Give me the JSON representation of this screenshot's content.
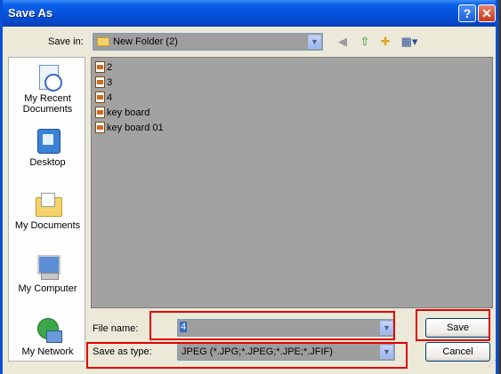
{
  "window": {
    "title": "Save As",
    "help_glyph": "?",
    "close_glyph": "✕"
  },
  "toolbar": {
    "save_in_label": "Save in:",
    "save_in_value": "New Folder (2)",
    "icons": [
      "back-icon",
      "up-folder-icon",
      "new-folder-icon",
      "views-menu-icon"
    ]
  },
  "places": [
    {
      "label": "My Recent Documents",
      "icon": "recent-documents-icon"
    },
    {
      "label": "Desktop",
      "icon": "desktop-icon"
    },
    {
      "label": "My Documents",
      "icon": "my-documents-icon"
    },
    {
      "label": "My Computer",
      "icon": "my-computer-icon"
    },
    {
      "label": "My Network",
      "icon": "my-network-icon"
    }
  ],
  "files": [
    "2",
    "3",
    "4",
    "key board",
    "key board 01"
  ],
  "form": {
    "file_name_label": "File name:",
    "file_name_value": "4",
    "save_as_type_label": "Save as type:",
    "save_as_type_value": "JPEG (*.JPG;*.JPEG;*.JPE;*.JFIF)"
  },
  "buttons": {
    "save": "Save",
    "cancel": "Cancel"
  },
  "colors": {
    "title_bar": "#0553dc",
    "dialog_bg": "#ece9d8",
    "list_bg": "#a2a2a2",
    "highlight_box": "#e00000"
  }
}
